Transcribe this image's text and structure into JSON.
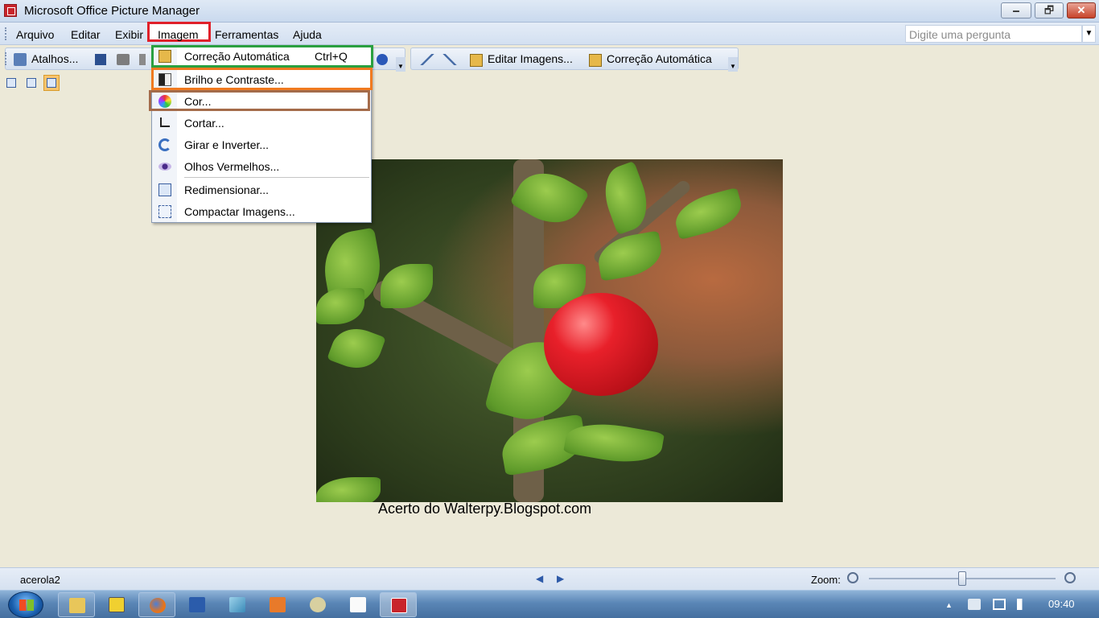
{
  "window": {
    "title": "Microsoft Office Picture Manager",
    "min_label": "🗕",
    "max_label": "🗗",
    "close_label": "✕"
  },
  "menubar": {
    "items": [
      "Arquivo",
      "Editar",
      "Exibir",
      "Imagem",
      "Ferramentas",
      "Ajuda"
    ],
    "help_placeholder": "Digite uma pergunta"
  },
  "toolbar": {
    "shortcuts_label": "Atalhos...",
    "edit_images_label": "Editar Imagens...",
    "auto_correct_label": "Correção Automática"
  },
  "image_menu": {
    "items": [
      {
        "label": "Correção Automática",
        "shortcut": "Ctrl+Q",
        "icon": "auto-correct-icon"
      },
      {
        "label": "Brilho e Contraste...",
        "icon": "brightness-icon"
      },
      {
        "label": "Cor...",
        "icon": "color-icon"
      },
      {
        "label": "Cortar...",
        "icon": "crop-icon"
      },
      {
        "label": "Girar e Inverter...",
        "icon": "rotate-icon"
      },
      {
        "label": "Olhos Vermelhos...",
        "icon": "red-eye-icon"
      },
      {
        "label": "Redimensionar...",
        "icon": "resize-icon"
      },
      {
        "label": "Compactar Imagens...",
        "icon": "compress-icon"
      }
    ]
  },
  "photo": {
    "caption": "Acerto do Walterpy.Blogspot.com"
  },
  "statusbar": {
    "filename": "acerola2",
    "zoom_label": "Zoom:",
    "zoom_level": 0.5
  },
  "taskbar": {
    "clock": "09:40"
  },
  "colors": {
    "highlight_menu": "#e0202a",
    "highlight_auto": "#2aa040",
    "highlight_brightness": "#f07a20",
    "highlight_color": "#a46b4a"
  }
}
